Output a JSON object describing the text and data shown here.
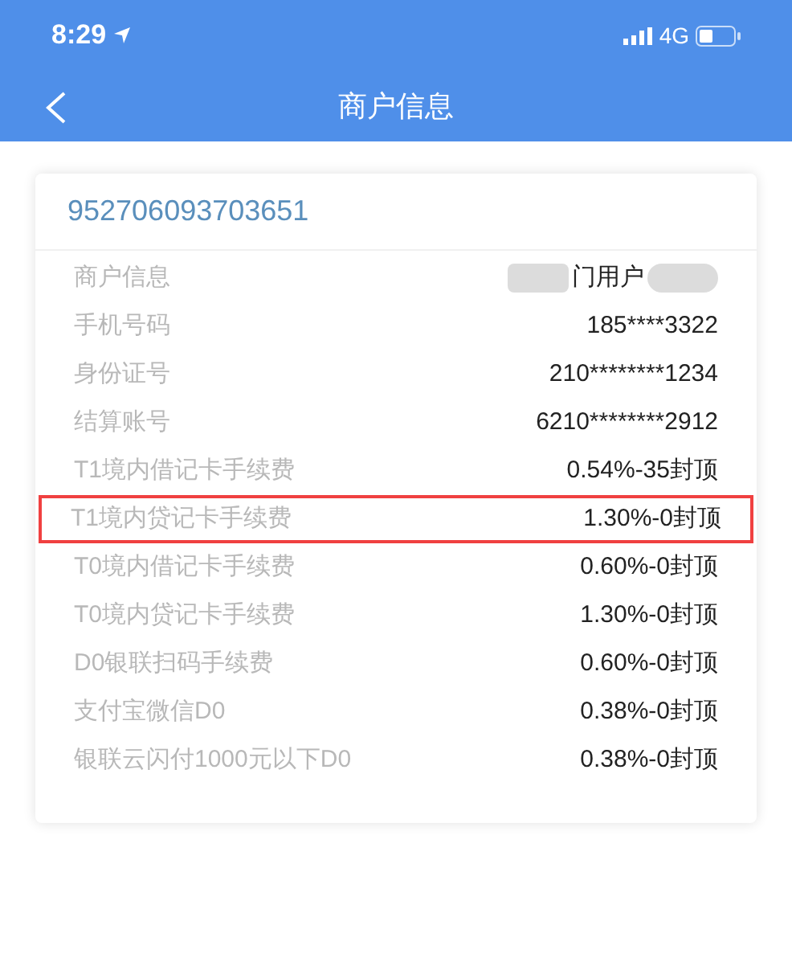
{
  "status_bar": {
    "time": "8:29",
    "network": "4G"
  },
  "nav": {
    "title": "商户信息"
  },
  "card": {
    "merchant_id": "952706093703651",
    "rows": [
      {
        "label": "商户信息",
        "value": "门用户",
        "redacted": true,
        "highlighted": false
      },
      {
        "label": "手机号码",
        "value": "185****3322",
        "redacted": false,
        "highlighted": false
      },
      {
        "label": "身份证号",
        "value": "210********1234",
        "redacted": false,
        "highlighted": false
      },
      {
        "label": "结算账号",
        "value": "6210********2912",
        "redacted": false,
        "highlighted": false
      },
      {
        "label": "T1境内借记卡手续费",
        "value": "0.54%-35封顶",
        "redacted": false,
        "highlighted": false
      },
      {
        "label": "T1境内贷记卡手续费",
        "value": "1.30%-0封顶",
        "redacted": false,
        "highlighted": true
      },
      {
        "label": "T0境内借记卡手续费",
        "value": "0.60%-0封顶",
        "redacted": false,
        "highlighted": false
      },
      {
        "label": "T0境内贷记卡手续费",
        "value": "1.30%-0封顶",
        "redacted": false,
        "highlighted": false
      },
      {
        "label": "D0银联扫码手续费",
        "value": "0.60%-0封顶",
        "redacted": false,
        "highlighted": false
      },
      {
        "label": "支付宝微信D0",
        "value": "0.38%-0封顶",
        "redacted": false,
        "highlighted": false
      },
      {
        "label": "银联云闪付1000元以下D0",
        "value": "0.38%-0封顶",
        "redacted": false,
        "highlighted": false
      }
    ]
  }
}
